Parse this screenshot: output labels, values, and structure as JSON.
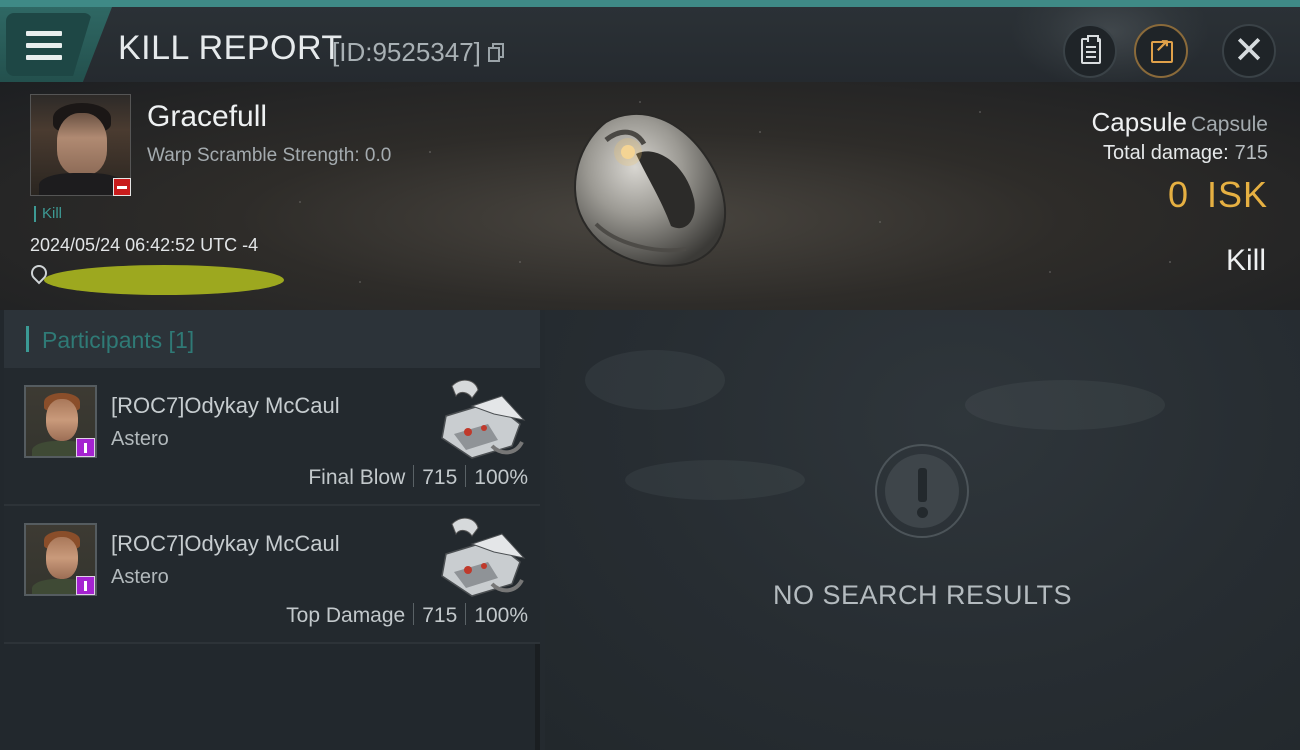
{
  "header": {
    "title": "KILL REPORT",
    "id_label": "[ID:9525347]"
  },
  "victim": {
    "name": "Gracefull",
    "warp_scramble": "Warp Scramble Strength: 0.0",
    "tag": "Kill",
    "timestamp": "2024/05/24 06:42:52 UTC -4",
    "ship_name": "Capsule",
    "ship_class": "Capsule",
    "total_damage_label": "Total damage:",
    "total_damage_value": "715",
    "isk_value": "0",
    "isk_unit": "ISK",
    "result_label": "Kill"
  },
  "participants": {
    "header": "Participants [1]",
    "rows": [
      {
        "name": "[ROC7]Odykay McCaul",
        "ship": "Astero",
        "role": "Final Blow",
        "damage": "715",
        "percent": "100%"
      },
      {
        "name": "[ROC7]Odykay McCaul",
        "ship": "Astero",
        "role": "Top Damage",
        "damage": "715",
        "percent": "100%"
      }
    ]
  },
  "right_panel": {
    "empty_message": "NO SEARCH RESULTS"
  },
  "colors": {
    "accent_teal": "#3b9a95",
    "isk_gold": "#e6b042",
    "victim_badge": "#c81c1c",
    "participant_badge": "#a523d1",
    "redaction": "#9da81f"
  },
  "icons": [
    "menu-icon",
    "copy-icon",
    "clipboard-icon",
    "share-icon",
    "close-icon",
    "location-pin-icon",
    "alert-icon"
  ]
}
